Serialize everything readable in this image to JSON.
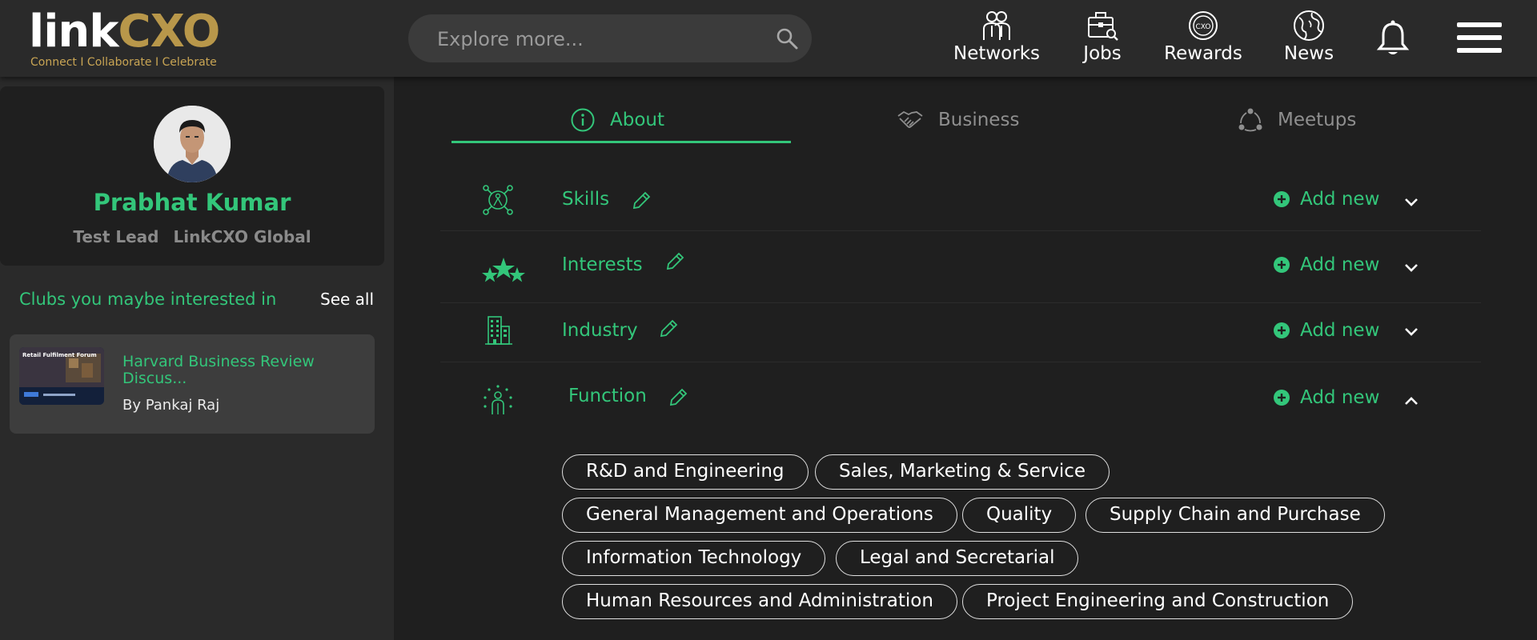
{
  "header": {
    "logo_link": "link",
    "logo_cxo": "CXO",
    "logo_tagline": "Connect I Collaborate I Celebrate",
    "search_placeholder": "Explore more...",
    "nav": [
      {
        "label": "Networks",
        "icon": "networks-icon"
      },
      {
        "label": "Jobs",
        "icon": "jobs-icon"
      },
      {
        "label": "Rewards",
        "icon": "rewards-icon"
      },
      {
        "label": "News",
        "icon": "globe-icon"
      }
    ],
    "rewards_badge_text": "CXO"
  },
  "profile": {
    "name": "Prabhat Kumar",
    "role": "Test Lead",
    "company": "LinkCXO Global"
  },
  "clubs": {
    "title": "Clubs you maybe interested in",
    "see_all": "See all",
    "items": [
      {
        "title": "Harvard Business Review Discus...",
        "author": "By Pankaj Raj",
        "thumb_text": "Retail Fulfilment Forum"
      }
    ]
  },
  "tabs": [
    {
      "label": "About",
      "active": true
    },
    {
      "label": "Business",
      "active": false
    },
    {
      "label": "Meetups",
      "active": false
    }
  ],
  "sections": [
    {
      "label": "Skills",
      "add_label": "Add new",
      "expanded": false
    },
    {
      "label": "Interests",
      "add_label": "Add new",
      "expanded": false
    },
    {
      "label": "Industry",
      "add_label": "Add new",
      "expanded": false
    },
    {
      "label": "Function",
      "add_label": "Add new",
      "expanded": true
    }
  ],
  "function_chips": [
    "R&D and Engineering",
    "Sales, Marketing & Service",
    "General Management and Operations",
    "Quality",
    "Supply Chain and Purchase",
    "Information Technology",
    "Legal and Secretarial",
    "Human Resources and Administration",
    "Project Engineering and Construction"
  ],
  "colors": {
    "accent": "#33c67a",
    "gold": "#b8974a",
    "background": "#2a2a2a",
    "panel": "#1f1f1f"
  }
}
